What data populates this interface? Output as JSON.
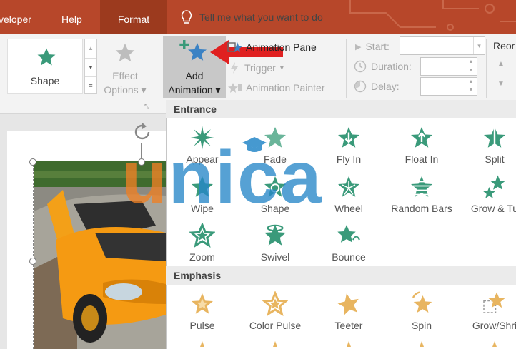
{
  "menu": {
    "tabs": [
      "veloper",
      "Help",
      "Format"
    ],
    "tell_me": "Tell me what you want to do"
  },
  "ribbon": {
    "shape_label": "Shape",
    "effect_options": [
      "Effect",
      "Options"
    ],
    "add_animation": [
      "Add",
      "Animation"
    ],
    "animation_pane": "Animation Pane",
    "trigger": "Trigger",
    "animation_painter": "Animation Painter",
    "start_label": "Start:",
    "duration_label": "Duration:",
    "delay_label": "Delay:",
    "reorder_label": "Reor"
  },
  "gallery": {
    "entrance_header": "Entrance",
    "emphasis_header": "Emphasis",
    "entrance": [
      "Appear",
      "Fade",
      "Fly In",
      "Float In",
      "Split",
      "Wipe",
      "Shape",
      "Wheel",
      "Random Bars",
      "Grow & Tu",
      "Zoom",
      "Swivel",
      "Bounce"
    ],
    "emphasis": [
      "Pulse",
      "Color Pulse",
      "Teeter",
      "Spin",
      "Grow/Shri"
    ]
  },
  "watermark": {
    "u": "u",
    "rest": "nica"
  },
  "colors": {
    "title_bar": "#b7472a",
    "entrance_star": "#3a9a7a",
    "emphasis_star": "#e8b560",
    "pointer_arrow": "#e02020",
    "selection_blue": "#3b82c4"
  },
  "icons": [
    "lightbulb-icon",
    "star-icon",
    "add-animation-icon",
    "animation-pane-icon",
    "trigger-icon",
    "painter-icon",
    "clock-icon",
    "rotate-handle-icon",
    "red-arrow-icon"
  ]
}
